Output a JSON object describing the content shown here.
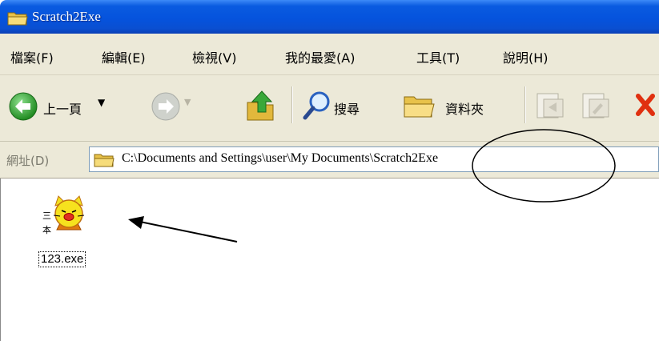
{
  "window": {
    "title": "Scratch2Exe"
  },
  "menu": {
    "items": [
      "檔案(F)",
      "編輯(E)",
      "檢視(V)",
      "我的最愛(A)",
      "工具(T)",
      "說明(H)"
    ]
  },
  "toolbar": {
    "back_label": "上一頁",
    "search_label": "搜尋",
    "folders_label": "資料夾"
  },
  "address": {
    "label": "網址(D)",
    "path": "C:\\Documents and Settings\\user\\My Documents\\Scratch2Exe"
  },
  "files": [
    {
      "name": "123.exe",
      "icon": "cat-exe-icon"
    }
  ],
  "colors": {
    "titlebar": "#0553dd",
    "chrome": "#ece9d8",
    "back_green": "#2e9b2e",
    "close_red": "#e03010"
  }
}
